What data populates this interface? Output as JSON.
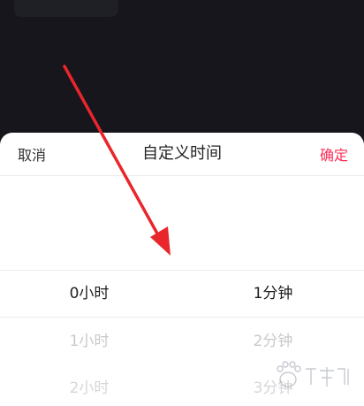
{
  "sheet": {
    "title": "自定义时间",
    "cancel_label": "取消",
    "confirm_label": "确定"
  },
  "picker": {
    "hours": [
      "0小时",
      "1小时",
      "2小时"
    ],
    "minutes": [
      "1分钟",
      "2分钟",
      "3分钟"
    ],
    "selected_hours": "0小时",
    "selected_minutes": "1分钟"
  },
  "colors": {
    "accent": "#fe2c55",
    "annotation_arrow": "#e8262b"
  },
  "icons": {
    "annotation": "red-arrow-icon",
    "watermark": "baidu-paw-watermark-icon"
  }
}
